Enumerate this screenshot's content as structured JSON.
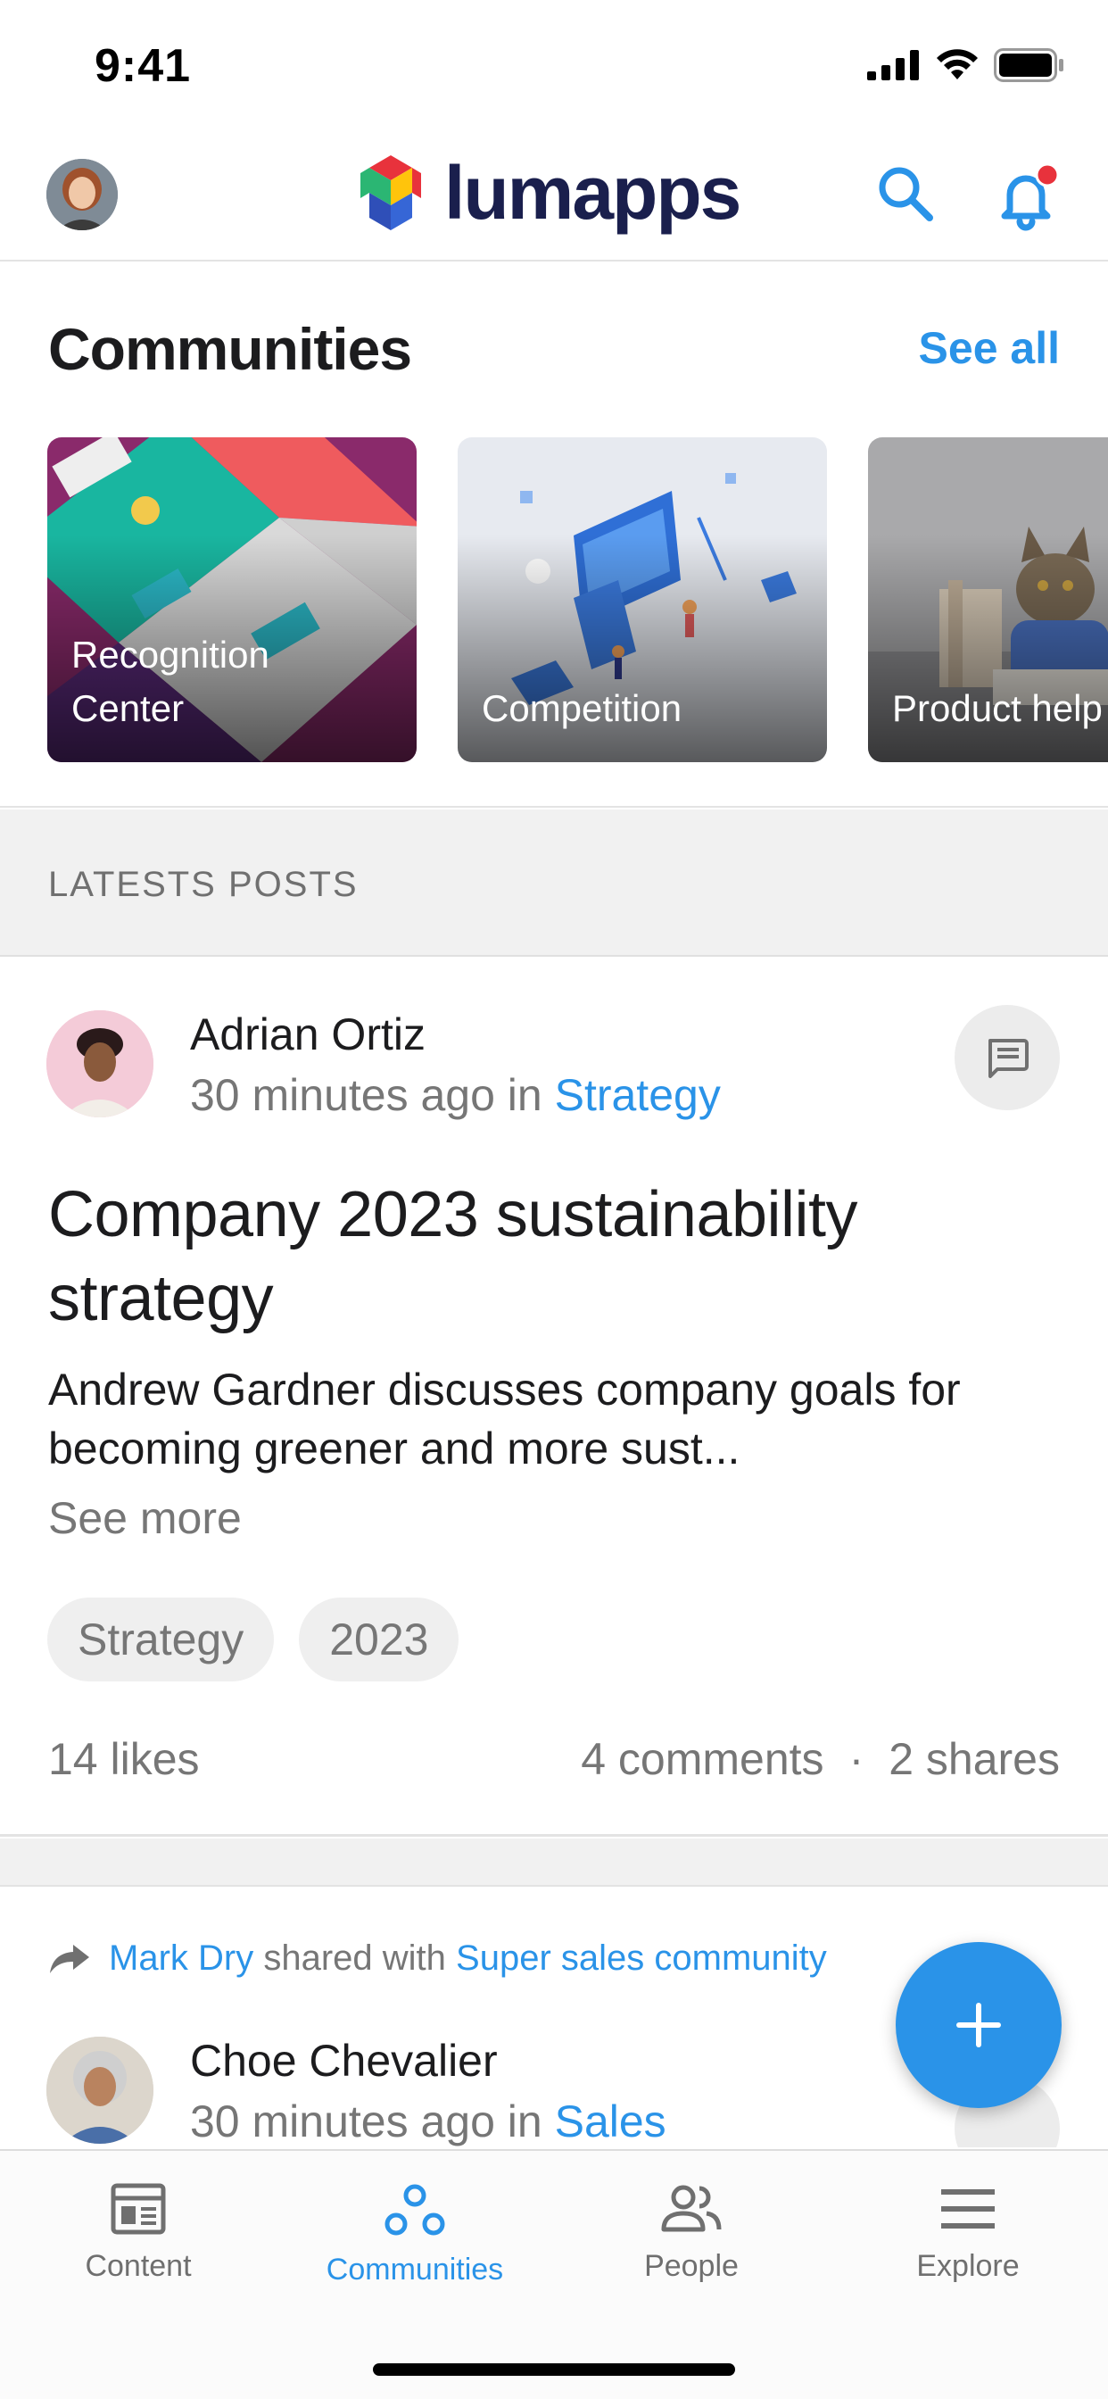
{
  "status_bar": {
    "time": "9:41"
  },
  "header": {
    "logo_text": "lumapps",
    "avatar": "user-avatar",
    "search_icon": "search-icon",
    "bell_icon": "bell-icon",
    "notification_dot_color": "#e8323c"
  },
  "communities": {
    "title": "Communities",
    "see_all_label": "See all",
    "cards": [
      {
        "label_line1": "Recognition",
        "label_line2": "Center"
      },
      {
        "label_line1": "Competition"
      },
      {
        "label_line1": "Product help"
      }
    ]
  },
  "latest": {
    "label": "LATESTS POSTS"
  },
  "post": {
    "author": "Adrian Ortiz",
    "time": "30 minutes ago in",
    "community": "Strategy",
    "title": "Company 2023 sustainability strategy",
    "body": "Andrew Gardner discusses company goals for becoming greener and more sust...",
    "see_more": "See more",
    "tags": [
      "Strategy",
      "2023"
    ],
    "likes": "14 likes",
    "comments": "4 comments",
    "separator": "·",
    "shares": "2 shares"
  },
  "post2": {
    "sharer": "Mark Dry",
    "shared_text": "shared with",
    "shared_to": "Super sales community",
    "author": "Choe Chevalier",
    "time": "30 minutes ago in",
    "community": "Sales"
  },
  "tabs": [
    {
      "label": "Content",
      "icon": "content-icon"
    },
    {
      "label": "Communities",
      "icon": "communities-icon",
      "active": true
    },
    {
      "label": "People",
      "icon": "people-icon"
    },
    {
      "label": "Explore",
      "icon": "menu-icon"
    }
  ],
  "colors": {
    "accent": "#2a93e8",
    "logo_text": "#1a1f4d"
  }
}
